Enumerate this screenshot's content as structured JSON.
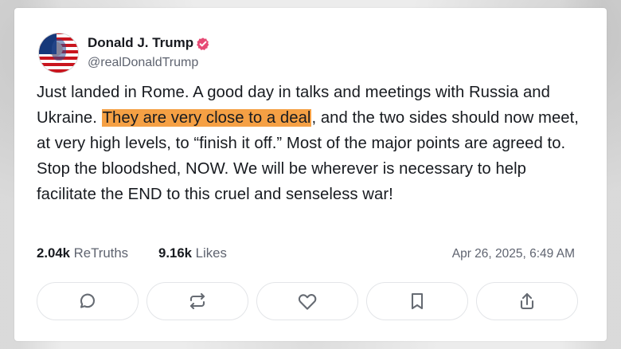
{
  "post": {
    "author": {
      "name": "Donald J. Trump",
      "handle": "@realDonaldTrump"
    },
    "text": {
      "before_highlight": "Just landed in Rome. A good day in talks and meetings with Russia and Ukraine. ",
      "highlight": "They are very close to a deal",
      "after_highlight": ", and the two sides should now meet, at very high levels, to “finish it off.” Most of the major points are agreed to. Stop the bloodshed, NOW. We will be wherever is necessary to help facilitate the END to this cruel and senseless war!"
    },
    "stats": {
      "retruths_count": "2.04k",
      "retruths_label": "ReTruths",
      "likes_count": "9.16k",
      "likes_label": "Likes",
      "timestamp": "Apr 26, 2025, 6:49 AM"
    }
  },
  "actions": [
    {
      "icon": "comment-icon"
    },
    {
      "icon": "repost-icon"
    },
    {
      "icon": "heart-icon"
    },
    {
      "icon": "bookmark-icon"
    },
    {
      "icon": "share-icon"
    }
  ],
  "colors": {
    "highlight": "#f5a044",
    "verified": "#e64b75",
    "text": "#181b20",
    "muted": "#5f6470"
  }
}
